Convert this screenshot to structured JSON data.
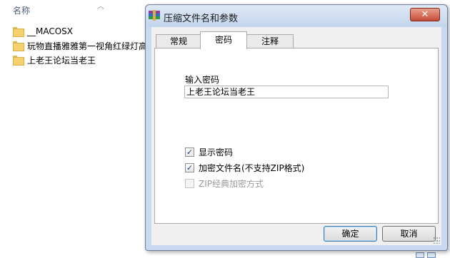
{
  "explorer": {
    "column_header": "名称",
    "files": [
      {
        "name": "__MACOSX",
        "icon": "folder-icon"
      },
      {
        "name": "玩物直播雅雅第一视角红绿灯高",
        "icon": "folder-icon"
      },
      {
        "name": "上老王论坛当老王",
        "icon": "folder-icon"
      }
    ]
  },
  "dialog": {
    "title": "压缩文件名和参数",
    "close_label": "✕",
    "tabs": [
      {
        "label": "常规",
        "active": false
      },
      {
        "label": "密码",
        "active": true
      },
      {
        "label": "注释",
        "active": false
      }
    ],
    "password": {
      "label": "输入密码",
      "value": "上老王论坛当老王"
    },
    "options": [
      {
        "label": "显示密码",
        "checked": true,
        "enabled": true
      },
      {
        "label": "加密文件名(不支持ZIP格式)",
        "checked": true,
        "enabled": true
      },
      {
        "label": "ZIP经典加密方式",
        "checked": false,
        "enabled": false
      }
    ],
    "ok_label": "确定",
    "cancel_label": "取消"
  },
  "colors": {
    "title_bar": "#c3d5ec",
    "close_button": "#c64a36",
    "folder": "#f5d06c"
  }
}
